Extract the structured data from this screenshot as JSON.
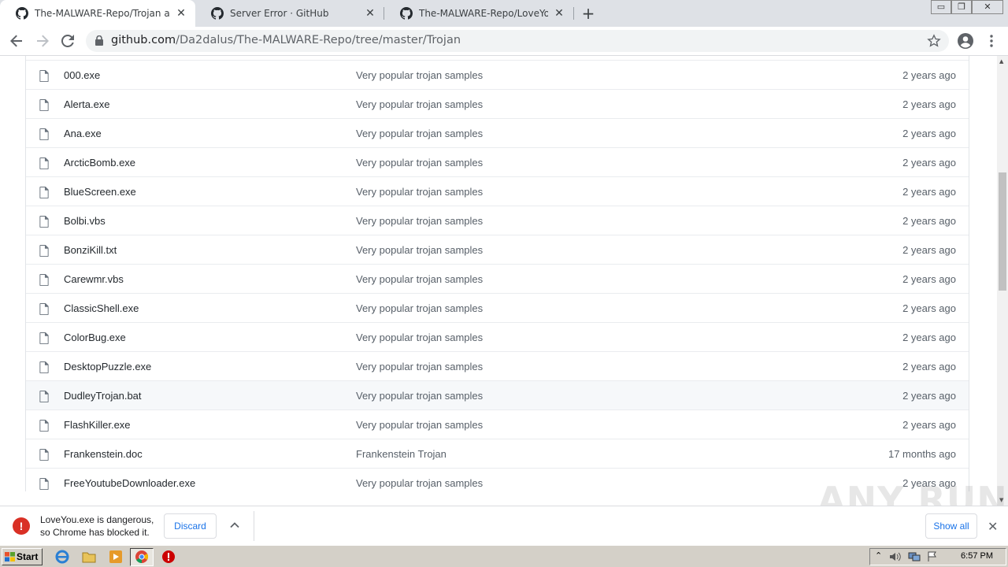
{
  "browser": {
    "tabs": [
      {
        "title": "The-MALWARE-Repo/Trojan at mast",
        "active": true
      },
      {
        "title": "Server Error · GitHub",
        "active": false
      },
      {
        "title": "The-MALWARE-Repo/LoveYou.exe a",
        "active": false
      }
    ],
    "window_controls": {
      "minimize": "▭",
      "restore": "❐",
      "close": "✕"
    },
    "url_host": "github.com",
    "url_path": "/Da2dalus/The-MALWARE-Repo/tree/master/Trojan"
  },
  "files": [
    {
      "name": "000.exe",
      "message": "Very popular trojan samples",
      "age": "2 years ago"
    },
    {
      "name": "Alerta.exe",
      "message": "Very popular trojan samples",
      "age": "2 years ago"
    },
    {
      "name": "Ana.exe",
      "message": "Very popular trojan samples",
      "age": "2 years ago"
    },
    {
      "name": "ArcticBomb.exe",
      "message": "Very popular trojan samples",
      "age": "2 years ago"
    },
    {
      "name": "BlueScreen.exe",
      "message": "Very popular trojan samples",
      "age": "2 years ago"
    },
    {
      "name": "Bolbi.vbs",
      "message": "Very popular trojan samples",
      "age": "2 years ago"
    },
    {
      "name": "BonziKill.txt",
      "message": "Very popular trojan samples",
      "age": "2 years ago"
    },
    {
      "name": "Carewmr.vbs",
      "message": "Very popular trojan samples",
      "age": "2 years ago"
    },
    {
      "name": "ClassicShell.exe",
      "message": "Very popular trojan samples",
      "age": "2 years ago"
    },
    {
      "name": "ColorBug.exe",
      "message": "Very popular trojan samples",
      "age": "2 years ago"
    },
    {
      "name": "DesktopPuzzle.exe",
      "message": "Very popular trojan samples",
      "age": "2 years ago"
    },
    {
      "name": "DudleyTrojan.bat",
      "message": "Very popular trojan samples",
      "age": "2 years ago"
    },
    {
      "name": "FlashKiller.exe",
      "message": "Very popular trojan samples",
      "age": "2 years ago"
    },
    {
      "name": "Frankenstein.doc",
      "message": "Frankenstein Trojan",
      "age": "17 months ago"
    },
    {
      "name": "FreeYoutubeDownloader.exe",
      "message": "Very popular trojan samples",
      "age": "2 years ago"
    }
  ],
  "download_bar": {
    "message_line1": "LoveYou.exe is dangerous,",
    "message_line2": "so Chrome has blocked it.",
    "discard_label": "Discard",
    "show_all_label": "Show all"
  },
  "watermark": "ANY RUN",
  "taskbar": {
    "start_label": "Start",
    "clock": "6:57 PM"
  },
  "colors": {
    "danger": "#d93025",
    "link_blue": "#1a73e8",
    "tab_strip": "#dee1e6"
  }
}
